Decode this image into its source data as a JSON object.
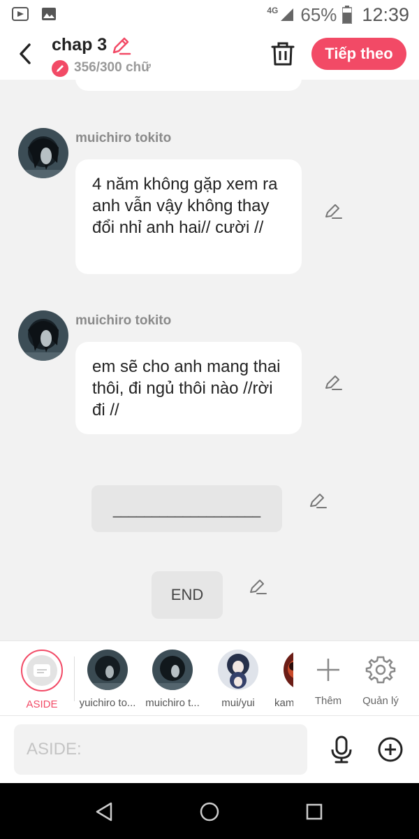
{
  "status_bar": {
    "network": "4G",
    "battery": "65%",
    "time": "12:39"
  },
  "header": {
    "title": "chap 3",
    "word_count": "356/300 chữ",
    "next_button": "Tiếp theo"
  },
  "messages": [
    {
      "sender": "muichiro tokito",
      "text": "4 năm không gặp xem ra anh vẫn vậy không thay đổi nhỉ anh hai// cười //"
    },
    {
      "sender": "muichiro tokito",
      "text": "em sẽ cho anh mang thai thôi, đi ngủ thôi nào //rời đi //"
    }
  ],
  "aside_text": "___________________",
  "end_text": "END",
  "characters": [
    {
      "label": "ASIDE"
    },
    {
      "label": "yuichiro to..."
    },
    {
      "label": "muichiro t..."
    },
    {
      "label": "mui/yui"
    },
    {
      "label": "kam"
    }
  ],
  "tools": {
    "add_label": "Thêm",
    "manage_label": "Quản lý"
  },
  "composer": {
    "placeholder": "ASIDE:"
  },
  "colors": {
    "accent": "#f24a66",
    "background": "#f2f2f2"
  }
}
